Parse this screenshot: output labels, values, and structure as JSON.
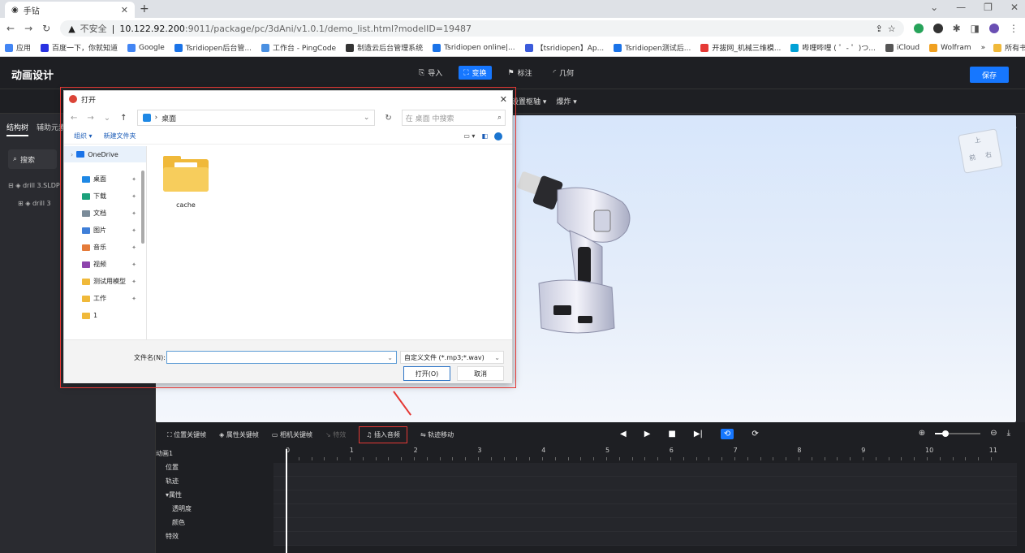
{
  "browser": {
    "tab_title": "手钻",
    "url_insecure": "不安全",
    "url_host": "10.122.92.200",
    "url_rest": ":9011/package/pc/3dAni/v1.0.1/demo_list.html?modelID=19487",
    "bookmarks": [
      {
        "label": "应用",
        "color": "#4285f4"
      },
      {
        "label": "百度一下，你就知道",
        "color": "#2932e1"
      },
      {
        "label": "Google",
        "color": "#4285f4"
      },
      {
        "label": "Tsridiopen后台管...",
        "color": "#1a73e8"
      },
      {
        "label": "工作台 - PingCode",
        "color": "#4a90e2"
      },
      {
        "label": "制造云后台管理系统",
        "color": "#333333"
      },
      {
        "label": "Tsridiopen online|...",
        "color": "#1a73e8"
      },
      {
        "label": "【tsridiopen】Ap...",
        "color": "#3b5bdb"
      },
      {
        "label": "Tsridiopen测试后...",
        "color": "#1a73e8"
      },
      {
        "label": "开拔网_机械三维模...",
        "color": "#e53935"
      },
      {
        "label": "哔哩哔哩 ( ゜- ゜)つ...",
        "color": "#00a1d6"
      },
      {
        "label": "iCloud",
        "color": "#555555"
      },
      {
        "label": "Wolfram",
        "color": "#f0a020"
      }
    ],
    "bookmarks_more": "»",
    "all_bookmarks": "所有书签"
  },
  "app": {
    "title": "动画设计",
    "modes": [
      {
        "label": "导入",
        "active": false
      },
      {
        "label": "变换",
        "active": true
      },
      {
        "label": "标注",
        "active": false
      },
      {
        "label": "几何",
        "active": false
      }
    ],
    "save_label": "保存",
    "toolbar2": [
      "设置枢轴 ▾",
      "爆炸 ▾"
    ],
    "sidebar": {
      "tabs": [
        "结构树",
        "辅助元素"
      ],
      "search_label": "搜索",
      "tree": [
        "drill 3.SLDP",
        "drill 3"
      ]
    },
    "collapse_icon": "⇤"
  },
  "dialog": {
    "title": "打开",
    "path": "桌面",
    "search_placeholder": "在 桌面 中搜索",
    "organize": "组织 ▾",
    "new_folder": "新建文件夹",
    "nav_items": [
      {
        "label": "OneDrive",
        "color": "#1a73e8",
        "pinned": false
      },
      {
        "label": "桌面",
        "color": "#1e88e5",
        "pinned": true
      },
      {
        "label": "下载",
        "color": "#1ba17b",
        "pinned": true
      },
      {
        "label": "文档",
        "color": "#7a8b99",
        "pinned": true
      },
      {
        "label": "图片",
        "color": "#3f7fd8",
        "pinned": true
      },
      {
        "label": "音乐",
        "color": "#e57b3a",
        "pinned": true
      },
      {
        "label": "视频",
        "color": "#8e44ad",
        "pinned": true
      },
      {
        "label": "测试用模型",
        "color": "#f0b93a",
        "pinned": true
      },
      {
        "label": "工作",
        "color": "#f0b93a",
        "pinned": true
      },
      {
        "label": "1",
        "color": "#f0b93a",
        "pinned": false
      }
    ],
    "files": [
      {
        "name": "cache"
      }
    ],
    "filename_label": "文件名(N):",
    "filename_value": "",
    "filetype": "自定义文件 (*.mp3;*.wav)",
    "open_button": "打开(O)",
    "cancel_button": "取消"
  },
  "timeline": {
    "tools": [
      {
        "label": "位置关键帧",
        "dim": false,
        "hl": false
      },
      {
        "label": "属性关键帧",
        "dim": false,
        "hl": false
      },
      {
        "label": "相机关键帧",
        "dim": false,
        "hl": false
      },
      {
        "label": "特效",
        "dim": true,
        "hl": false
      },
      {
        "label": "插入音频",
        "dim": false,
        "hl": true
      },
      {
        "label": "轨迹移动",
        "dim": false,
        "hl": false
      }
    ],
    "anim_name": "动画1",
    "track_labels": [
      "位置",
      "轨迹",
      "▾属性",
      "透明度",
      "颜色",
      "特效"
    ],
    "ruler": [
      "0",
      "1",
      "2",
      "3",
      "4",
      "5",
      "6",
      "7",
      "8",
      "9",
      "10",
      "11"
    ],
    "zoom_level": 0.22
  },
  "colors": {
    "accent": "#1677ff",
    "highlight": "#e53935"
  }
}
